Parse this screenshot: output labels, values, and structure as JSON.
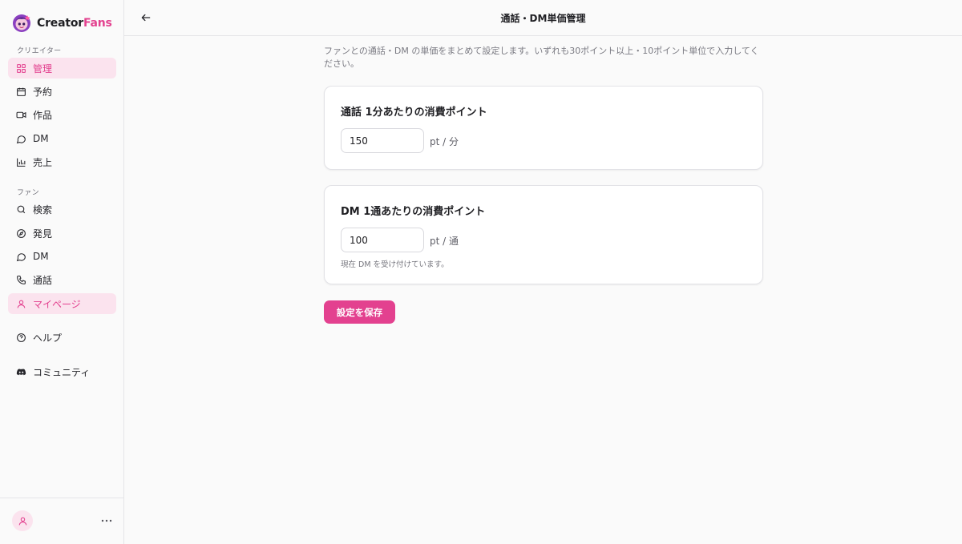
{
  "brand": {
    "name_main": "Creator",
    "name_accent": "Fans"
  },
  "colors": {
    "accent": "#e3418f",
    "active_bg": "#fbe3ee"
  },
  "sidebar": {
    "creator_section": "クリエイター",
    "creator_items": [
      {
        "label": "管理",
        "icon": "grid-icon",
        "active": true
      },
      {
        "label": "予約",
        "icon": "calendar-icon",
        "active": false
      },
      {
        "label": "作品",
        "icon": "video-icon",
        "active": false
      },
      {
        "label": "DM",
        "icon": "chat-icon",
        "active": false
      },
      {
        "label": "売上",
        "icon": "bar-chart-icon",
        "active": false
      }
    ],
    "fan_section": "ファン",
    "fan_items": [
      {
        "label": "検索",
        "icon": "search-icon",
        "active": false
      },
      {
        "label": "発見",
        "icon": "compass-icon",
        "active": false
      },
      {
        "label": "DM",
        "icon": "chat-icon",
        "active": false
      },
      {
        "label": "通話",
        "icon": "phone-icon",
        "active": false
      },
      {
        "label": "マイページ",
        "icon": "user-icon",
        "active": true
      }
    ],
    "help": {
      "label": "ヘルプ",
      "icon": "help-circle-icon"
    },
    "community": {
      "label": "コミュニティ",
      "icon": "discord-icon"
    },
    "footer": {
      "avatar_icon": "user-icon",
      "more_icon": "more-horizontal-icon"
    }
  },
  "header": {
    "title": "通話・DM単価管理",
    "back_icon": "arrow-left-icon"
  },
  "main": {
    "intro": "ファンとの通話・DM の単価をまとめて設定します。いずれも30ポイント以上・10ポイント単位で入力してください。",
    "call_card": {
      "title": "通話 1分あたりの消費ポイント",
      "value": "150",
      "unit": "pt / 分"
    },
    "dm_card": {
      "title": "DM 1通あたりの消費ポイント",
      "value": "100",
      "unit": "pt / 通",
      "note": "現在 DM を受け付けています。"
    },
    "save_label": "設定を保存"
  }
}
